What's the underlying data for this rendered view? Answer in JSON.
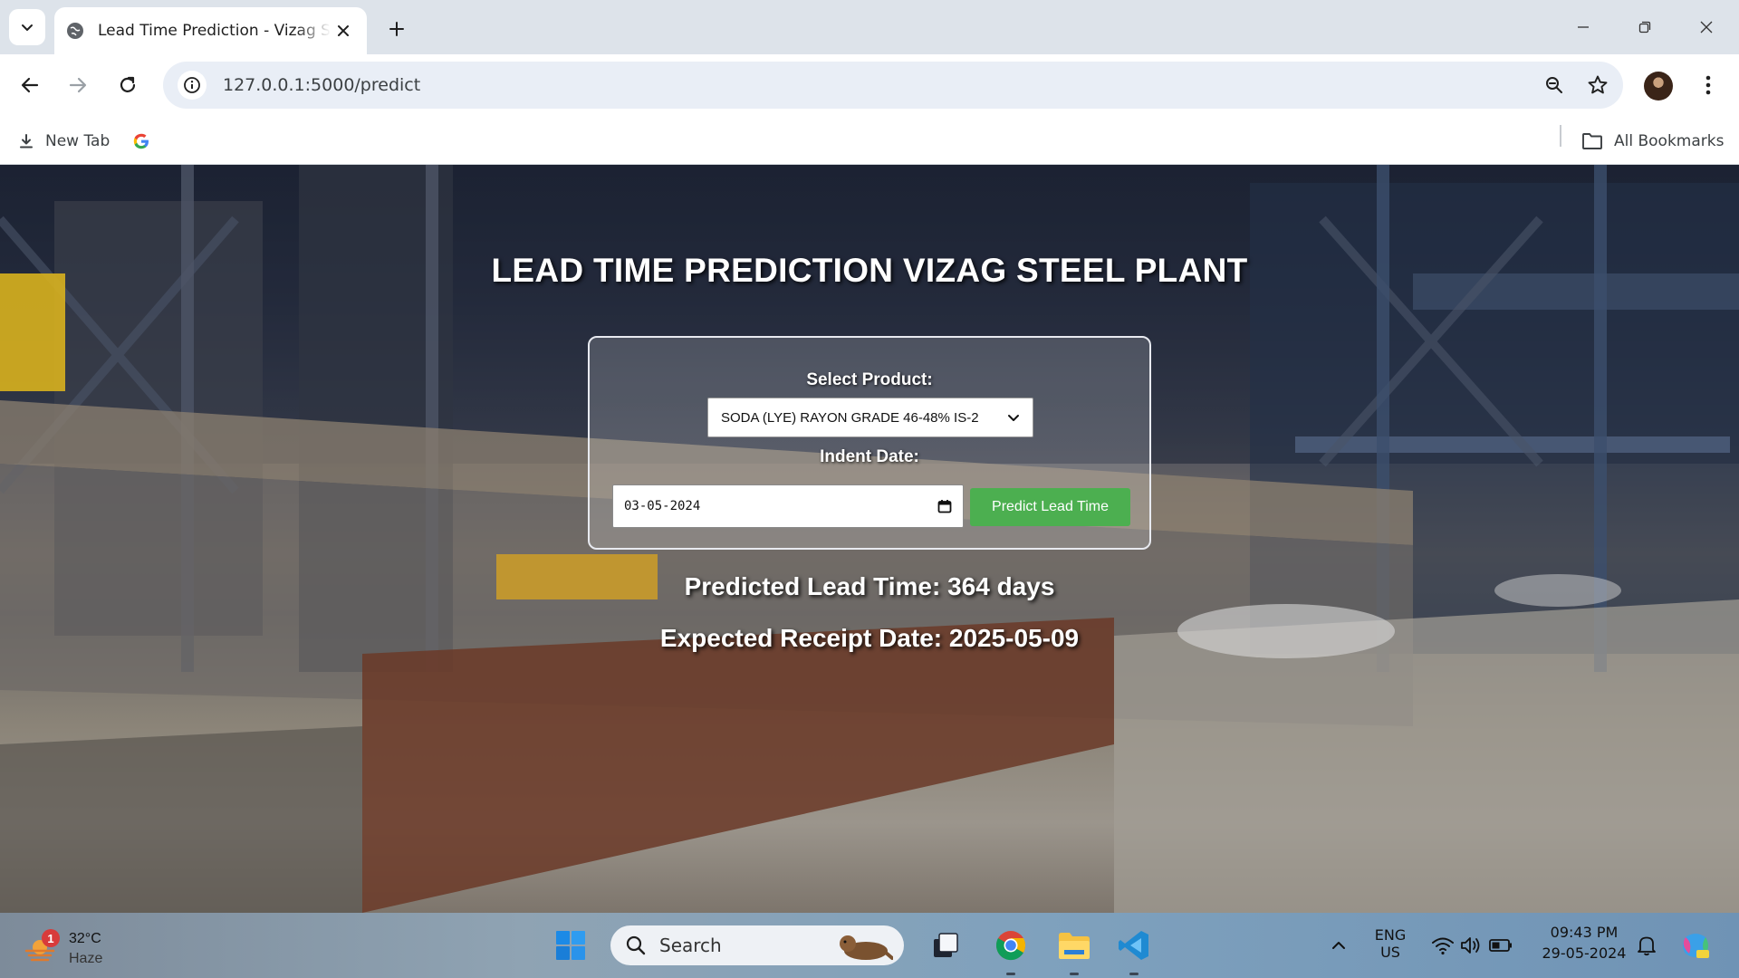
{
  "browser": {
    "tab_title": "Lead Time Prediction - Vizag Steel Plant",
    "url": "127.0.0.1:5000/predict",
    "bookmarks": [
      {
        "label": "New Tab",
        "icon": "download-icon"
      },
      {
        "label": "",
        "icon": "google-icon"
      }
    ],
    "all_bookmarks_label": "All Bookmarks"
  },
  "page": {
    "title": "LEAD TIME PREDICTION VIZAG STEEL PLANT",
    "form": {
      "product_label": "Select Product:",
      "product_value": "SODA (LYE) RAYON GRADE 46-48% IS-2",
      "indent_date_label": "Indent Date:",
      "indent_date_value": "03-05-2024",
      "submit_label": "Predict Lead Time"
    },
    "results": {
      "lead_time": "Predicted Lead Time: 364 days",
      "receipt_date": "Expected Receipt Date: 2025-05-09"
    },
    "colors": {
      "button": "#4caf50",
      "text": "#ffffff"
    }
  },
  "taskbar": {
    "weather": {
      "temp": "32°C",
      "condition": "Haze",
      "badge": "1"
    },
    "search_label": "Search",
    "language": {
      "line1": "ENG",
      "line2": "US"
    },
    "clock": {
      "time": "09:43 PM",
      "date": "29-05-2024"
    }
  }
}
